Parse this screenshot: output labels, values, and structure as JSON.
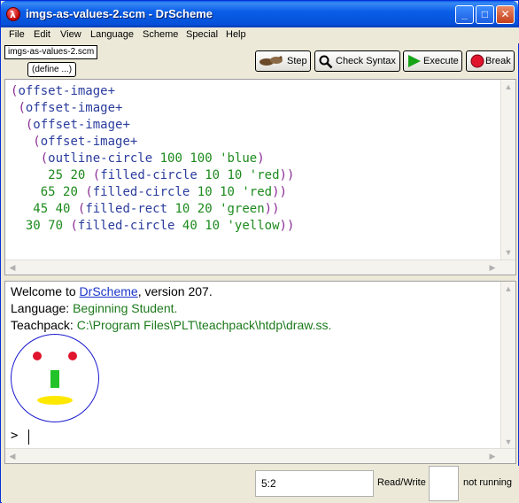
{
  "window": {
    "title": "imgs-as-values-2.scm - DrScheme"
  },
  "menubar": {
    "items": [
      "File",
      "Edit",
      "View",
      "Language",
      "Scheme",
      "Special",
      "Help"
    ]
  },
  "filetab": "imgs-as-values-2.scm",
  "define_button": "(define ...)",
  "toolbar": {
    "step": "Step",
    "check_syntax": "Check Syntax",
    "execute": "Execute",
    "break": "Break"
  },
  "definitions": {
    "lines": [
      "(offset-image+",
      " (offset-image+",
      "  (offset-image+",
      "   (offset-image+",
      "    (outline-circle 100 100 'blue)",
      "     25 20 (filled-circle 10 10 'red))",
      "    65 20 (filled-circle 10 10 'red))",
      "   45 40 (filled-rect 10 20 'green))",
      "  30 70 (filled-circle 40 10 'yellow))"
    ]
  },
  "interactions": {
    "welcome_prefix": "Welcome to ",
    "welcome_link": "DrScheme",
    "welcome_suffix": ", version 207.",
    "language_label": "Language: ",
    "language_value": "Beginning Student.",
    "teachpack_label": "Teachpack: ",
    "teachpack_value": "C:\\Program Files\\PLT\\teachpack\\htdp\\draw.ss.",
    "prompt": ">"
  },
  "status": {
    "position": "5:2",
    "mode": "Read/Write",
    "run_state": "not running"
  },
  "colors": {
    "title_blue": "#0a5ee8",
    "keyword": "#7d2bb5",
    "number": "#1c8a1c",
    "link": "#1a34c9"
  }
}
